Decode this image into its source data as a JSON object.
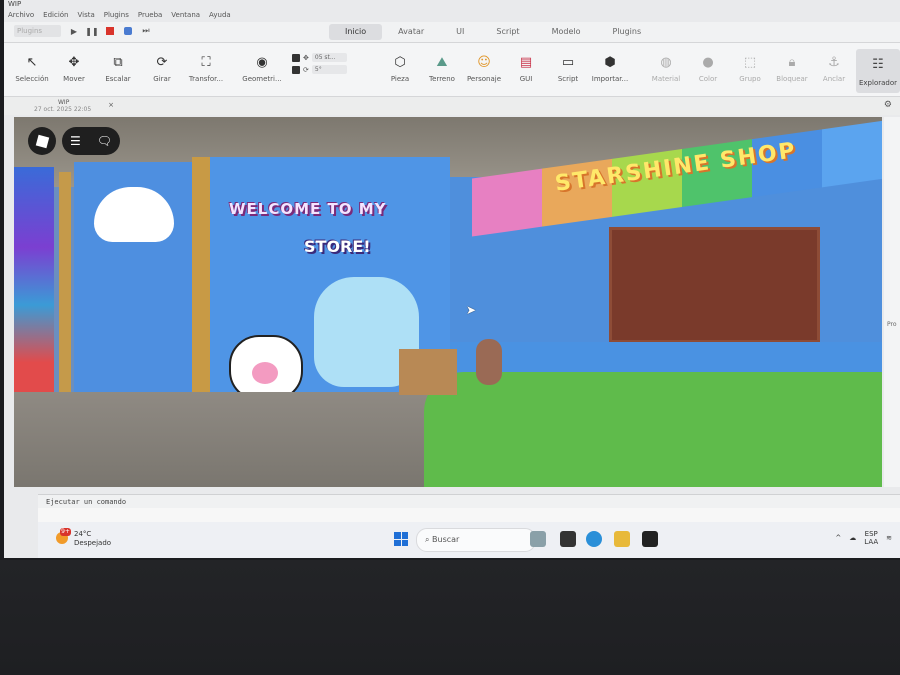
{
  "window": {
    "title": "WIP"
  },
  "menu": [
    "Archivo",
    "Edición",
    "Vista",
    "Plugins",
    "Prueba",
    "Ventana",
    "Ayuda"
  ],
  "quickbar": {
    "selector": "Plugins"
  },
  "main_tabs": [
    {
      "label": "Inicio",
      "active": true
    },
    {
      "label": "Avatar",
      "active": false
    },
    {
      "label": "UI",
      "active": false
    },
    {
      "label": "Script",
      "active": false
    },
    {
      "label": "Modelo",
      "active": false
    },
    {
      "label": "Plugins",
      "active": false
    }
  ],
  "ribbon": {
    "tools": [
      {
        "label": "Selección",
        "icon": "cursor-icon"
      },
      {
        "label": "Mover",
        "icon": "move-icon"
      },
      {
        "label": "Escalar",
        "icon": "scale-icon"
      },
      {
        "label": "Girar",
        "icon": "rotate-icon"
      },
      {
        "label": "Transfor...",
        "icon": "transform-icon"
      },
      {
        "label": "Geometri...",
        "icon": "geometry-icon"
      }
    ],
    "snap": {
      "move": "05 st...",
      "rotate": "5°"
    },
    "insert": [
      {
        "label": "Pieza",
        "icon": "part-icon",
        "dim": false
      },
      {
        "label": "Terreno",
        "icon": "terrain-icon",
        "dim": false
      },
      {
        "label": "Personaje",
        "icon": "character-icon",
        "dim": false
      },
      {
        "label": "GUI",
        "icon": "gui-icon",
        "dim": false
      },
      {
        "label": "Script",
        "icon": "script-icon",
        "dim": false
      },
      {
        "label": "Importar...",
        "icon": "import-icon",
        "dim": false
      },
      {
        "label": "Material",
        "icon": "material-icon",
        "dim": true
      },
      {
        "label": "Color",
        "icon": "color-icon",
        "dim": true
      },
      {
        "label": "Grupo",
        "icon": "group-icon",
        "dim": true
      },
      {
        "label": "Bloquear",
        "icon": "lock-icon",
        "dim": true
      },
      {
        "label": "Anclar",
        "icon": "anchor-icon",
        "dim": true
      }
    ],
    "explorer": "Explorador"
  },
  "doc_tab": {
    "name": "WIP",
    "date": "27 oct. 2025 22:05"
  },
  "scene": {
    "welcome": "WELCOME TO MY",
    "store": "STORE!",
    "sign": "STARSHINE SHOP"
  },
  "right_panel": {
    "tag": "Pro"
  },
  "command_bar": {
    "placeholder": "Ejecutar un comando"
  },
  "taskbar": {
    "weather_temp": "24°C",
    "weather_desc": "Despejado",
    "weather_badge": "9+",
    "search": "Buscar",
    "lang1": "ESP",
    "lang2": "LAA"
  }
}
